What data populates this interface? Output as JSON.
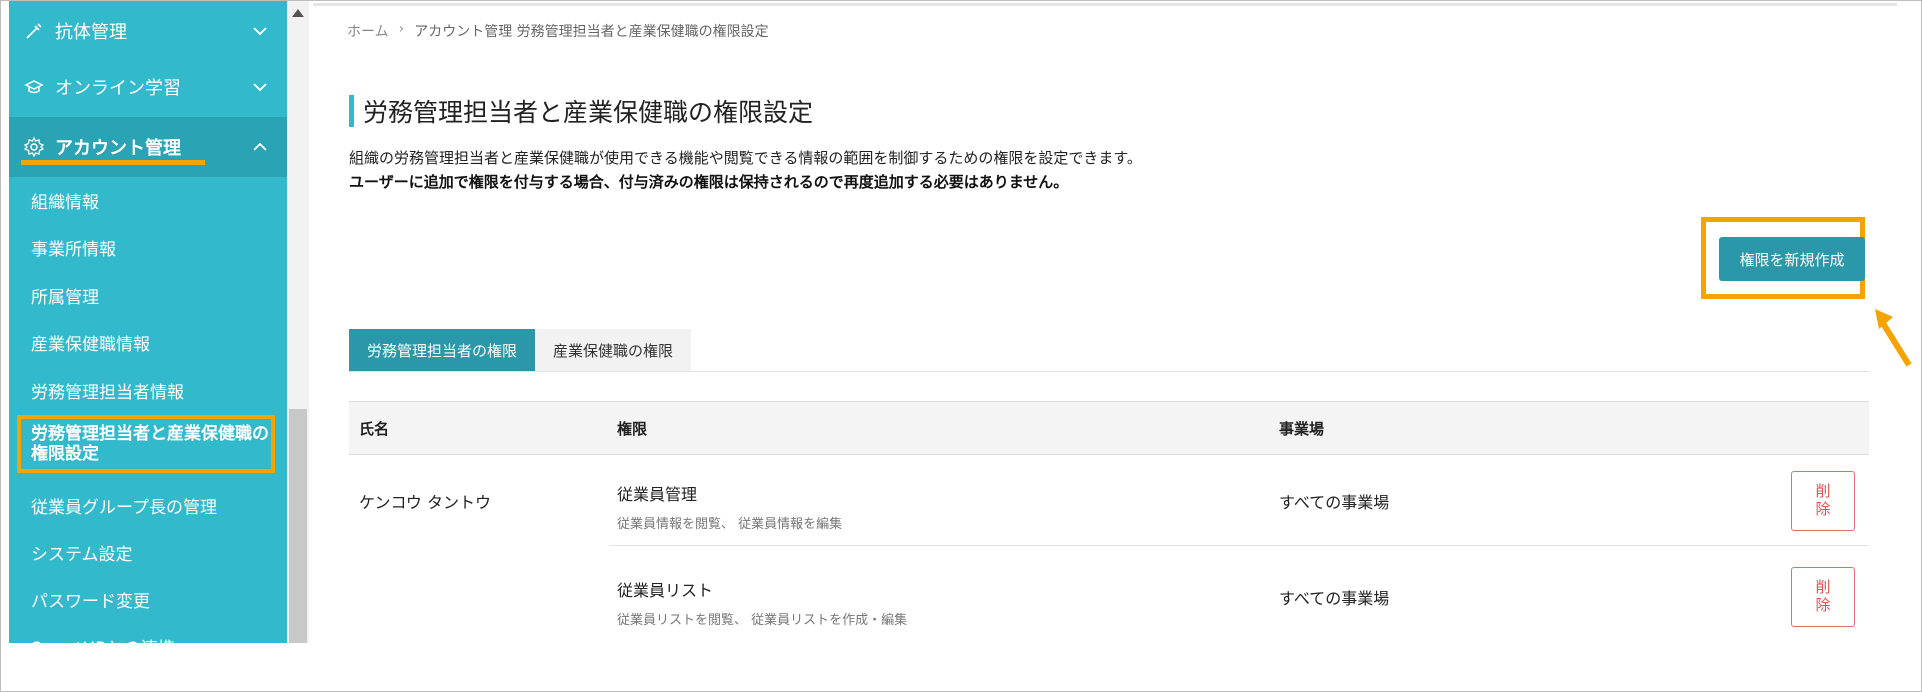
{
  "sidebar": {
    "sections": [
      {
        "label": "抗体管理",
        "icon": "syringe-icon"
      },
      {
        "label": "オンライン学習",
        "icon": "graduation-cap-icon"
      },
      {
        "label": "アカウント管理",
        "icon": "gear-icon"
      }
    ],
    "items": [
      {
        "label": "組織情報"
      },
      {
        "label": "事業所情報"
      },
      {
        "label": "所属管理"
      },
      {
        "label": "産業保健職情報"
      },
      {
        "label": "労務管理担当者情報"
      },
      {
        "label": "労務管理担当者と産業保健職の権限設定"
      },
      {
        "label": "従業員グループ長の管理"
      },
      {
        "label": "システム設定"
      },
      {
        "label": "パスワード変更"
      },
      {
        "label": "SmartHRとの連携"
      }
    ]
  },
  "breadcrumb": {
    "home": "ホーム",
    "separator": "›",
    "current": "アカウント管理 労務管理担当者と産業保健職の権限設定"
  },
  "page": {
    "title": "労務管理担当者と産業保健職の権限設定",
    "description": "組織の労務管理担当者と産業保健職が使用できる機能や閲覧できる情報の範囲を制御するための権限を設定できます。",
    "note": "ユーザーに追加で権限を付与する場合、付与済みの権限は保持されるので再度追加する必要はありません。",
    "new_button": "権限を新規作成"
  },
  "tabs": [
    {
      "label": "労務管理担当者の権限"
    },
    {
      "label": "産業保健職の権限"
    }
  ],
  "table": {
    "headers": {
      "name": "氏名",
      "permission": "権限",
      "site": "事業場"
    },
    "rows": [
      {
        "name": "ケンコウ タントウ",
        "permissions": [
          {
            "title": "従業員管理",
            "detail": "従業員情報を閲覧、 従業員情報を編集",
            "site": "すべての事業場",
            "delete": "削除"
          },
          {
            "title": "従業員リスト",
            "detail": "従業員リストを閲覧、 従業員リストを作成・編集",
            "site": "すべての事業場",
            "delete": "削除"
          }
        ]
      }
    ]
  },
  "colors": {
    "sidebar": "#32b9cc",
    "accent": "#2a98a8",
    "highlight": "#f5a300",
    "danger": "#e05050"
  }
}
